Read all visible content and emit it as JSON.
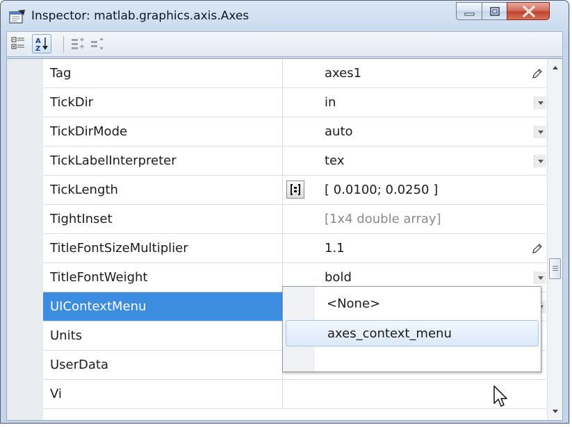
{
  "window": {
    "title": "Inspector:  matlab.graphics.axis.Axes",
    "icon": "inspector-app-icon"
  },
  "toolbar": {
    "buttons": [
      {
        "name": "categorize-button",
        "icon": "category-view-icon",
        "active": false
      },
      {
        "name": "sort-alphabetical-button",
        "icon": "sort-az-icon",
        "active": true
      },
      {
        "name": "expand-all-button",
        "icon": "expand-all-icon",
        "active": false
      },
      {
        "name": "collapse-all-button",
        "icon": "collapse-all-icon",
        "active": false
      }
    ]
  },
  "properties": [
    {
      "name": "Tag",
      "value": "axes1",
      "editor": "pencil"
    },
    {
      "name": "TickDir",
      "value": "in",
      "editor": "dropdown"
    },
    {
      "name": "TickDirMode",
      "value": "auto",
      "editor": "dropdown"
    },
    {
      "name": "TickLabelInterpreter",
      "value": "tex",
      "editor": "dropdown"
    },
    {
      "name": "TickLength",
      "value": "[ 0.0100; 0.0250 ]",
      "editor": "array-button"
    },
    {
      "name": "TightInset",
      "value": "[1x4  double array]",
      "editor": "readonly"
    },
    {
      "name": "TitleFontSizeMultiplier",
      "value": "1.1",
      "editor": "pencil"
    },
    {
      "name": "TitleFontWeight",
      "value": "bold",
      "editor": "dropdown"
    },
    {
      "name": "UIContextMenu",
      "value": "axes_context_menu",
      "editor": "dropdown",
      "selected": true
    },
    {
      "name": "Units",
      "value": "",
      "editor": "none"
    },
    {
      "name": "UserData",
      "value": "",
      "editor": "none"
    },
    {
      "name": "Vi",
      "value": "",
      "editor": "none"
    }
  ],
  "dropdown": {
    "options": [
      "<None>",
      "axes_context_menu"
    ],
    "highlighted": "axes_context_menu"
  },
  "colors": {
    "selection": "#3c8de0",
    "readonly_text": "#8a8a8a",
    "close_button": "#c0432d"
  }
}
